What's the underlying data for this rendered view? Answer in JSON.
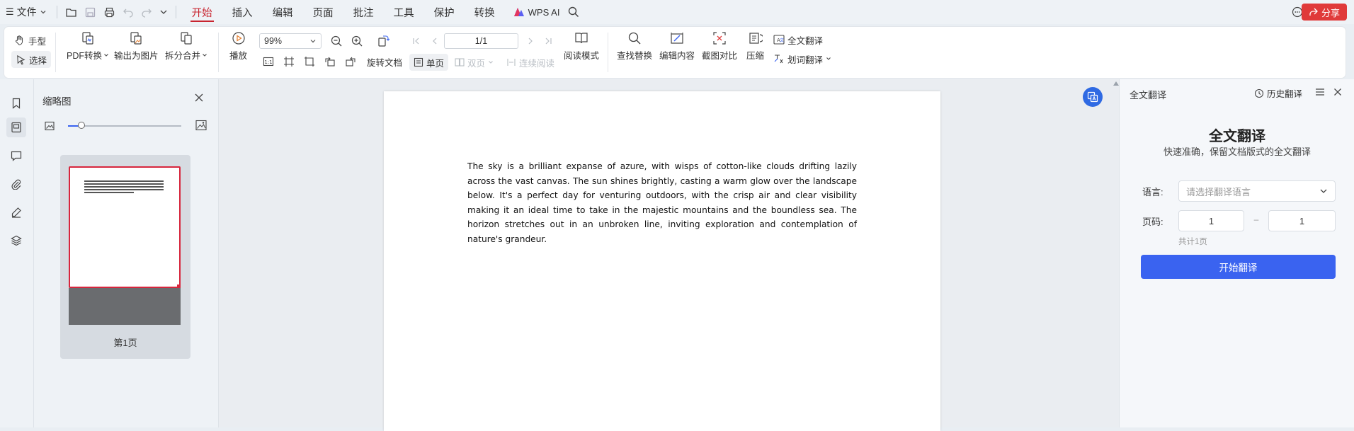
{
  "topbar": {
    "file_menu": "文件",
    "tabs": [
      {
        "label": "开始",
        "active": true
      },
      {
        "label": "插入"
      },
      {
        "label": "编辑"
      },
      {
        "label": "页面"
      },
      {
        "label": "批注"
      },
      {
        "label": "工具"
      },
      {
        "label": "保护"
      },
      {
        "label": "转换"
      }
    ],
    "wps_ai": "WPS AI",
    "share": "分享"
  },
  "ribbon": {
    "hand": "手型",
    "select": "选择",
    "pdf_convert": "PDF转换",
    "export_image": "输出为图片",
    "split_merge": "拆分合并",
    "play": "播放",
    "zoom": "99%",
    "page_number": "1/1",
    "rotate_doc": "旋转文档",
    "single_page": "单页",
    "double_page": "双页",
    "continuous": "连续阅读",
    "reading_mode": "阅读模式",
    "find_replace": "查找替换",
    "edit_content": "编辑内容",
    "screenshot_compare": "截图对比",
    "compress": "压缩",
    "full_translate": "全文翻译",
    "word_translate": "划词翻译"
  },
  "thumbnails": {
    "title": "缩略图",
    "slider_value": 0.12,
    "pages": [
      {
        "label": "第1页"
      }
    ]
  },
  "document": {
    "text": "The sky is a brilliant expanse of azure, with wisps of cotton-like clouds drifting lazily across the vast canvas. The sun shines brightly, casting a warm glow over the landscape below. It's a perfect day for venturing outdoors, with the crisp air and clear visibility making it an ideal time to take in the majestic mountains and the boundless sea. The horizon stretches out in an unbroken line, inviting exploration and contemplation of nature's grandeur."
  },
  "translate_panel": {
    "panel_title": "全文翻译",
    "history": "历史翻译",
    "heading": "全文翻译",
    "subheading": "快速准确，保留文档版式的全文翻译",
    "language_label": "语言:",
    "language_placeholder": "请选择翻译语言",
    "pages_label": "页码:",
    "page_from": "1",
    "page_separator": "–",
    "page_to": "1",
    "total_pages": "共计1页",
    "start_button": "开始翻译"
  },
  "colors": {
    "accent_red": "#c8242f",
    "share_red": "#e03a3a",
    "primary_blue": "#3a63f0"
  }
}
